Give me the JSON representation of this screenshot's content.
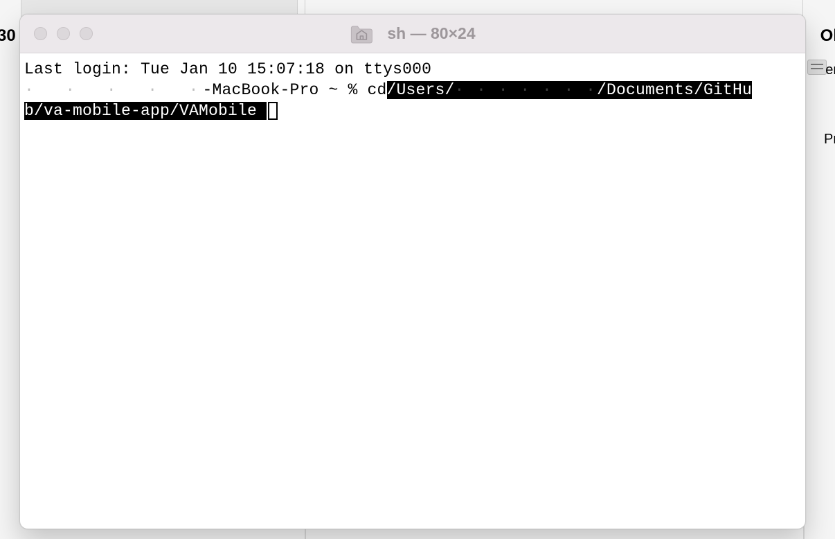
{
  "background": {
    "frag_left": "30",
    "frag_right_top": "Ol",
    "frag_right_mid1": "er",
    "frag_right_mid2": "Pr"
  },
  "window": {
    "title": "sh — 80×24"
  },
  "terminal": {
    "last_login": "Last login: Tue Jan 10 15:07:18 on ttys000",
    "prompt_host_suffix": "-MacBook-Pro ~ % ",
    "command_prefix": "cd",
    "path_seg1": "/Users/",
    "path_seg2": "/Documents/GitHu",
    "path_line2": "b/va-mobile-app/VAMobile "
  }
}
